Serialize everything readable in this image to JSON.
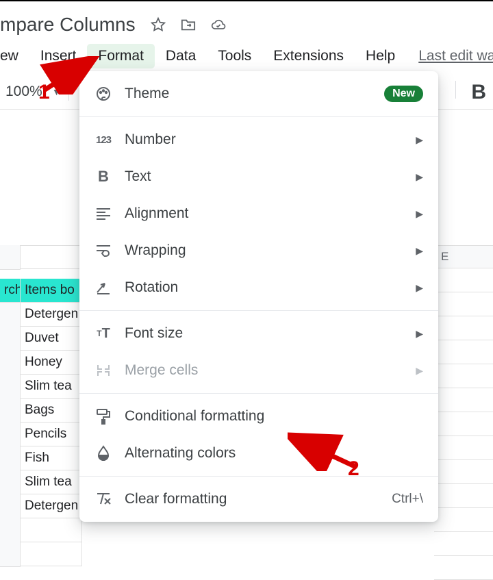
{
  "doc_title": "mpare Columns",
  "menubar": {
    "items": [
      "ew",
      "Insert",
      "Format",
      "Data",
      "Tools",
      "Extensions",
      "Help"
    ],
    "active_index": 2,
    "last_edit": "Last edit wa"
  },
  "toolbar": {
    "zoom": "100%",
    "bold_letter": "B"
  },
  "columns": {
    "e_label": "E"
  },
  "rows": {
    "header_a": "rch.",
    "header_b": "Items bo",
    "items": [
      "Detergen",
      "Duvet",
      "Honey",
      "Slim tea",
      "Bags",
      "Pencils",
      "Fish",
      "Slim tea",
      "Detergen"
    ]
  },
  "dropdown": {
    "theme": "Theme",
    "new_badge": "New",
    "number": "Number",
    "text": "Text",
    "alignment": "Alignment",
    "wrapping": "Wrapping",
    "rotation": "Rotation",
    "font_size": "Font size",
    "merge": "Merge cells",
    "conditional": "Conditional formatting",
    "alternating": "Alternating colors",
    "clear": "Clear formatting",
    "clear_shortcut": "Ctrl+\\"
  },
  "annotations": {
    "one": "1",
    "two": "2"
  }
}
